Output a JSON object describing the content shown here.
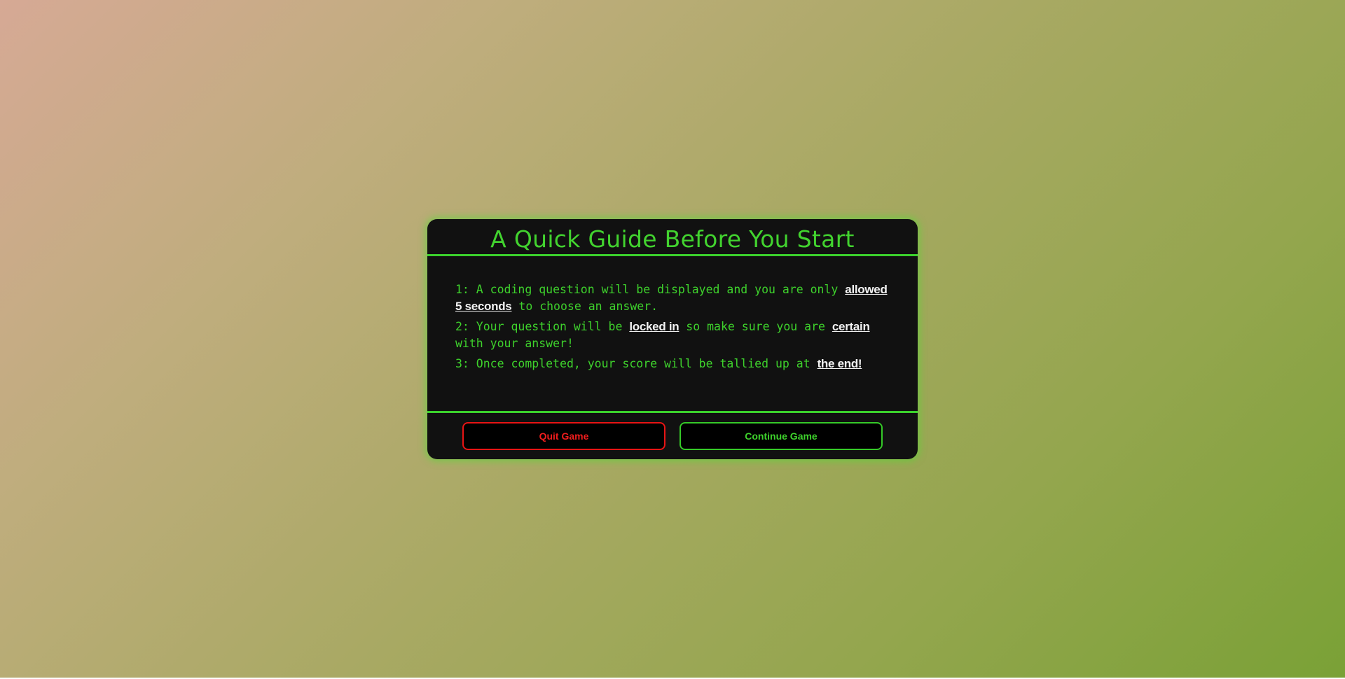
{
  "colors": {
    "accent_green": "#3ed22c",
    "quit_red": "#f01d1d",
    "panel_bg": "#111111",
    "highlight_text": "#f2f2f2"
  },
  "guide": {
    "title": "A Quick Guide Before You Start",
    "rules": [
      {
        "prefix": "1: A coding question will be displayed and you are only ",
        "highlight": "allowed 5 seconds",
        "suffix": " to choose an answer."
      },
      {
        "prefix": "2: Your question will be ",
        "highlight": "locked in",
        "middle": " so make sure you are ",
        "highlight2": "certain",
        "suffix": " with your answer!"
      },
      {
        "prefix": "3: Once completed, your score will be tallied up at ",
        "highlight": "the end!"
      }
    ]
  },
  "buttons": {
    "quit_label": "Quit Game",
    "continue_label": "Continue Game"
  }
}
